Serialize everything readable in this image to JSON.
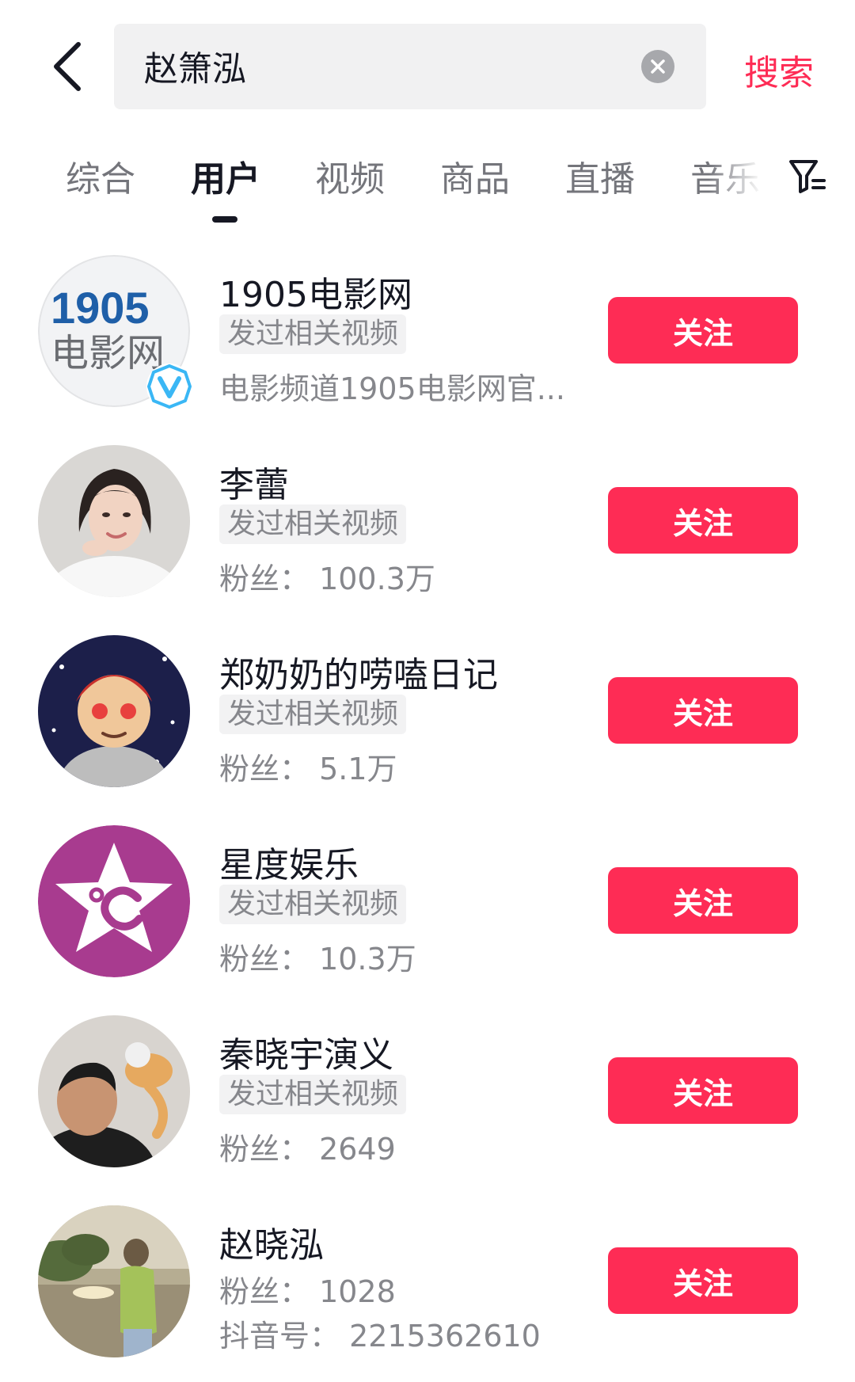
{
  "search": {
    "query": "赵箫泓",
    "submit_label": "搜索"
  },
  "tabs": [
    {
      "label": "综合"
    },
    {
      "label": "用户"
    },
    {
      "label": "视频"
    },
    {
      "label": "商品"
    },
    {
      "label": "直播"
    },
    {
      "label": "音乐"
    }
  ],
  "active_tab": "用户",
  "icons": {
    "back": "chevron-left-icon",
    "clear": "clear-circle-icon",
    "filter": "filter-icon",
    "verified": "verified-v-icon"
  },
  "colors": {
    "accent": "#fe2c55",
    "text_primary": "#161823",
    "text_secondary": "#86878c",
    "search_bg": "#f1f1f2"
  },
  "users": [
    {
      "name": "1905电影网",
      "tag": "发过相关视频",
      "meta1": "电影频道1905电影网官...",
      "meta2": "",
      "follow_label": "关注",
      "verified": true,
      "avatar_text_top": "1905",
      "avatar_text_bottom": "电影网"
    },
    {
      "name": "李蕾",
      "tag": "发过相关视频",
      "meta1": "粉丝：  100.3万",
      "meta2": "",
      "follow_label": "关注"
    },
    {
      "name": "郑奶奶的唠嗑日记",
      "tag": "发过相关视频",
      "meta1": "粉丝：  5.1万",
      "meta2": "",
      "follow_label": "关注"
    },
    {
      "name": "星度娱乐",
      "tag": "发过相关视频",
      "meta1": "粉丝：  10.3万",
      "meta2": "",
      "follow_label": "关注"
    },
    {
      "name": "秦晓宇演义",
      "tag": "发过相关视频",
      "meta1": "粉丝：  2649",
      "meta2": "",
      "follow_label": "关注"
    },
    {
      "name": "赵晓泓",
      "tag": "",
      "meta1": "粉丝：  1028",
      "meta2": "抖音号：  2215362610",
      "follow_label": "关注"
    }
  ]
}
